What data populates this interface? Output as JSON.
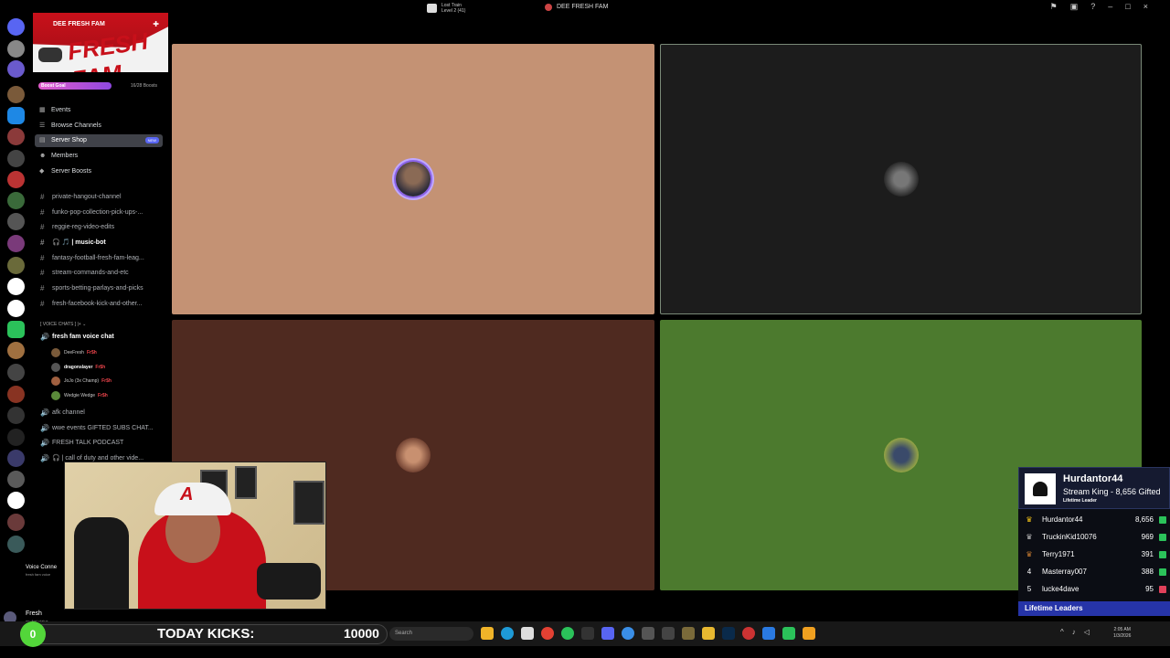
{
  "titlebar": {
    "game_line1": "Lost Train",
    "game_line2": "Level 2 (41)",
    "server_title": "DEE FRESH FAM"
  },
  "server": {
    "name": "DEE FRESH FAM",
    "banner_text": "FRESH FAM",
    "boost_label": "Boost Goal",
    "boost_count": "16/28 Boosts",
    "boost_progress": 0.57
  },
  "menu": [
    {
      "label": "Events",
      "icon": "calendar-icon"
    },
    {
      "label": "Browse Channels",
      "icon": "browse-icon"
    },
    {
      "label": "Server Shop",
      "icon": "shop-icon",
      "badge": "NEW",
      "active": true
    },
    {
      "label": "Members",
      "icon": "members-icon"
    },
    {
      "label": "Server Boosts",
      "icon": "boost-icon"
    }
  ],
  "channels": [
    {
      "label": "private-hangout-channel"
    },
    {
      "label": "funko-pop-collection-pick-ups-..."
    },
    {
      "label": "reggie-reg-video-edits"
    },
    {
      "label": "🎧 🎵 | music-bot",
      "bold": true
    },
    {
      "label": "fantasy-football-fresh-fam-leag..."
    },
    {
      "label": "stream-commands-and-etc"
    },
    {
      "label": "sports-betting-parlays-and-picks"
    },
    {
      "label": "fresh-facebook-kick-and-other..."
    }
  ],
  "voice_category": "[ VOICE CHATS ] |+ ⌄",
  "voice_channel": "fresh fam voice chat",
  "voice_users": [
    {
      "name": "DeeFresh",
      "tag": "Fr$h"
    },
    {
      "name": "dragonslayer",
      "tag": "Fr$h"
    },
    {
      "name": "JoJo (3x Champ)",
      "tag": "Fr$h"
    },
    {
      "name": "Wedgie Wedge",
      "tag": "Fr$h"
    }
  ],
  "more_channels": [
    {
      "label": "afk channel"
    },
    {
      "label": "wwe events GIFTED SUBS CHAT..."
    },
    {
      "label": "FRESH TALK PODCAST"
    },
    {
      "label": "🎧 | call of duty and other vide..."
    }
  ],
  "voice_connected": {
    "label": "Voice Conne",
    "sub": "fresh fam voice"
  },
  "user_panel": {
    "name": "Fresh",
    "status": "my first status"
  },
  "leaderboard": {
    "top_name": "Hurdantor44",
    "top_title": "Stream King - 8,656 Gifted",
    "top_sub": "Lifetime Leader",
    "rows": [
      {
        "rank": "♛",
        "user": "Hurdantor44",
        "value": "8,656"
      },
      {
        "rank": "♛",
        "user": "TruckinKid10076",
        "value": "969"
      },
      {
        "rank": "♛",
        "user": "Terry1971",
        "value": "391"
      },
      {
        "rank": "4",
        "user": "Masterray007",
        "value": "388"
      },
      {
        "rank": "5",
        "user": "lucke4dave",
        "value": "95"
      }
    ],
    "footer": "Lifetime Leaders"
  },
  "kicks": {
    "circle_value": "0",
    "label": "TODAY KICKS:",
    "value": "10000"
  },
  "taskbar": {
    "search_placeholder": "Search",
    "time": "2:05 AM",
    "date": "1/3/2026"
  },
  "colors": {
    "tile1": "#c49274",
    "tile2": "#1c1c1c",
    "tile3": "#4f2a20",
    "tile4": "#4c7a2e",
    "kick_green": "#53d63a",
    "leader_blue": "#2634a8"
  }
}
